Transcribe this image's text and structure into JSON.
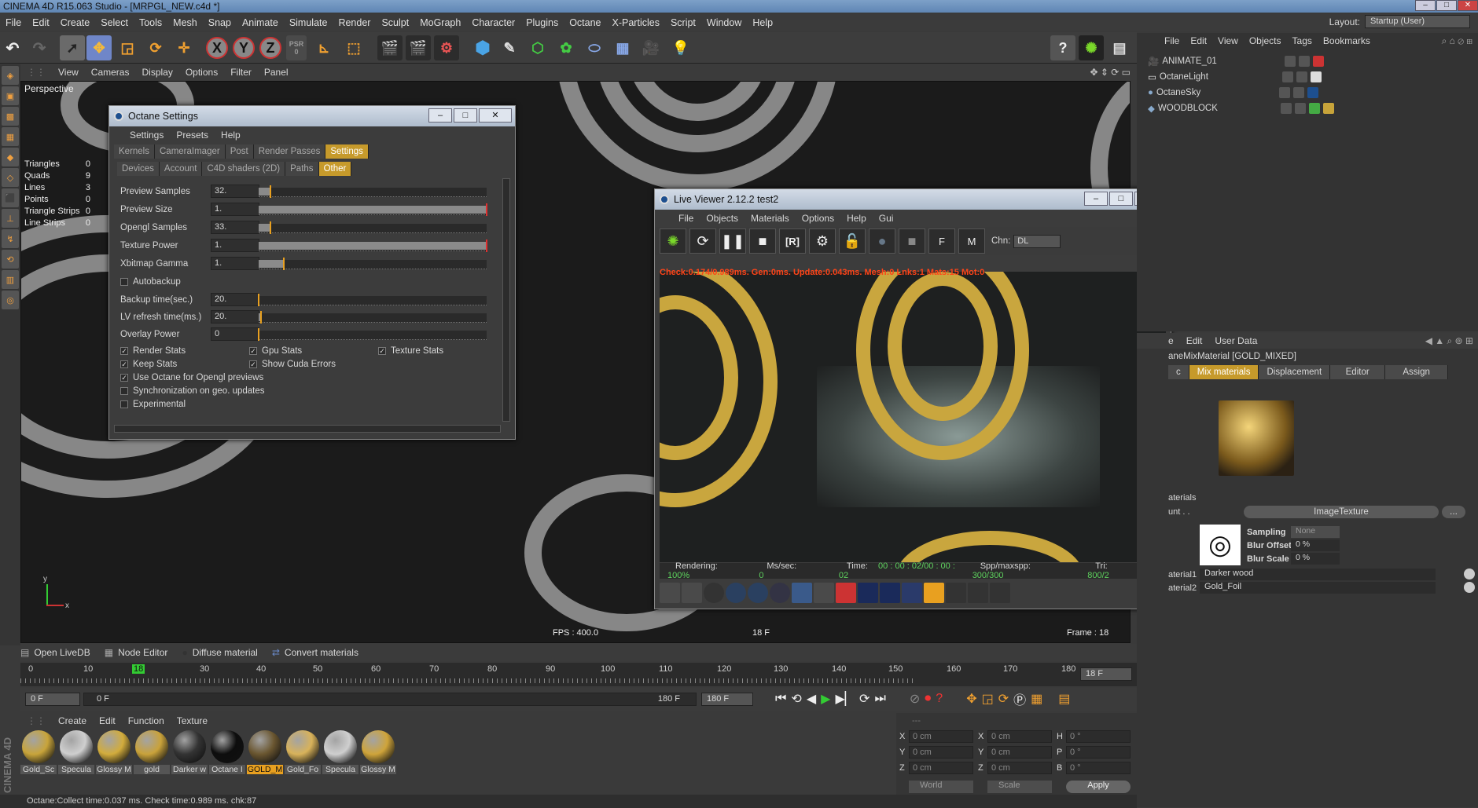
{
  "window": {
    "title": "CINEMA 4D R15.063 Studio - [MRPGL_NEW.c4d *]"
  },
  "menu": [
    "File",
    "Edit",
    "Create",
    "Select",
    "Tools",
    "Mesh",
    "Snap",
    "Animate",
    "Simulate",
    "Render",
    "Sculpt",
    "MoGraph",
    "Character",
    "Plugins",
    "Octane",
    "X-Particles",
    "Script",
    "Window",
    "Help"
  ],
  "layout": {
    "label": "Layout:",
    "value": "Startup (User)"
  },
  "toolbar": {
    "x": "X",
    "y": "Y",
    "z": "Z",
    "psr": "PSR",
    "psr_num": "0",
    "help": "?"
  },
  "viewport": {
    "menu": [
      "View",
      "Cameras",
      "Display",
      "Options",
      "Filter",
      "Panel"
    ],
    "label": "Perspective",
    "stats": [
      {
        "k": "Triangles",
        "v": "0"
      },
      {
        "k": "Quads",
        "v": "9"
      },
      {
        "k": "Lines",
        "v": "3"
      },
      {
        "k": "Points",
        "v": "0"
      },
      {
        "k": "Triangle Strips",
        "v": "0"
      },
      {
        "k": "Line Strips",
        "v": "0"
      }
    ],
    "fps": "FPS : 400.0",
    "frame_mid": "18 F",
    "frame": "Frame : 18",
    "axis_y": "y",
    "axis_x": "x"
  },
  "octane_settings": {
    "title": "Octane Settings",
    "menu": [
      "Settings",
      "Presets",
      "Help"
    ],
    "tabs1": [
      "Kernels",
      "CameraImager",
      "Post",
      "Render Passes",
      "Settings"
    ],
    "tabs2": [
      "Devices",
      "Account",
      "C4D shaders (2D)",
      "Paths",
      "Other"
    ],
    "sliders": [
      {
        "label": "Preview Samples",
        "value": "32.",
        "level": 0.05
      },
      {
        "label": "Preview Size",
        "value": "1.",
        "level": 1.0
      },
      {
        "label": "Opengl Samples",
        "value": "33.",
        "level": 0.05
      },
      {
        "label": "Texture Power",
        "value": "1.",
        "level": 1.0
      },
      {
        "label": "Xbitmap Gamma",
        "value": "1.",
        "level": 0.11
      }
    ],
    "autobackup": "Autobackup",
    "sliders2": [
      {
        "label": "Backup time(sec.)",
        "value": "20.",
        "level": 0.0
      },
      {
        "label": "LV refresh time(ms.)",
        "value": "20.",
        "level": 0.01
      },
      {
        "label": "Overlay Power",
        "value": "0",
        "level": 0.0
      }
    ],
    "checks": {
      "render_stats": "Render Stats",
      "gpu_stats": "Gpu Stats",
      "texture_stats": "Texture Stats",
      "keep_stats": "Keep Stats",
      "cuda_errors": "Show Cuda Errors",
      "opengl_prev": "Use Octane for Opengl previews",
      "sync": "Synchronization on geo. updates",
      "experimental": "Experimental"
    }
  },
  "live_viewer": {
    "title": "Live Viewer 2.12.2 test2",
    "menu": [
      "File",
      "Objects",
      "Materials",
      "Options",
      "Help",
      "Gui"
    ],
    "chn_label": "Chn:",
    "chn_value": "DL",
    "status": "Check:0.174/0.989ms. Gen:0ms. Update:0.043ms. Mesh:0 Lnks:1 Mats:15 Mot:0",
    "stats": {
      "rendering_k": "Rendering:",
      "rendering_v": "100%",
      "ms_k": "Ms/sec:",
      "ms_v": "0",
      "time_k": "Time:",
      "time_v": "00 : 00 : 02/00 : 00 : 02",
      "spp_k": "Spp/maxspp:",
      "spp_v": "300/300",
      "tri_k": "Tri:",
      "tri_v": "800/2",
      "extra": "M"
    }
  },
  "object_manager": {
    "menu": [
      "File",
      "Edit",
      "View",
      "Objects",
      "Tags",
      "Bookmarks"
    ],
    "items": [
      "ANIMATE_01",
      "OctaneLight",
      "OctaneSky",
      "WOODBLOCK"
    ]
  },
  "attribute_manager": {
    "menu": [
      "e",
      "Edit",
      "User Data"
    ],
    "title": "aneMixMaterial [GOLD_MIXED]",
    "tabs": [
      "c",
      "Mix materials",
      "Displacement",
      "Editor",
      "Assign"
    ],
    "section": "aterials",
    "shader_label": "unt . .",
    "shader_name": "ImageTexture",
    "more": "...",
    "sampling_k": "Sampling",
    "sampling_v": "None",
    "blur_offset_k": "Blur Offset",
    "blur_offset_v": "0 %",
    "blur_scale_k": "Blur Scale",
    "blur_scale_v": "0 %",
    "mat1_k": "aterial1",
    "mat1_v": "Darker wood",
    "mat2_k": "aterial2",
    "mat2_v": "Gold_Foil"
  },
  "timeline": {
    "bar": [
      "Open LiveDB",
      "Node Editor",
      "Diffuse material",
      "Convert materials"
    ],
    "ticks": [
      "0",
      "10",
      "18",
      "30",
      "40",
      "50",
      "60",
      "70",
      "80",
      "90",
      "100",
      "110",
      "120",
      "130",
      "140",
      "150",
      "160",
      "170",
      "180"
    ],
    "current": "18 F",
    "start": "0 F",
    "range_start": "0 F",
    "range_end": "180 F",
    "end": "180 F"
  },
  "material_manager": {
    "menu": [
      "Create",
      "Edit",
      "Function",
      "Texture"
    ],
    "items": [
      {
        "label": "Gold_Sc",
        "color": "#c8a43a"
      },
      {
        "label": "Specula",
        "color": "#cfcfcf"
      },
      {
        "label": "Glossy M",
        "color": "#d2ac3c"
      },
      {
        "label": "gold",
        "color": "#c9a23a"
      },
      {
        "label": "Darker w",
        "color": "#333333"
      },
      {
        "label": "Octane I",
        "color": "#0d0d0d"
      },
      {
        "label": "GOLD_M",
        "color": "#6a5630"
      },
      {
        "label": "Gold_Fo",
        "color": "#d8b25a"
      },
      {
        "label": "Specula",
        "color": "#cfcfcf"
      },
      {
        "label": "Glossy M",
        "color": "#cfa43a"
      }
    ]
  },
  "coords": {
    "header": "---",
    "x": "0 cm",
    "y": "0 cm",
    "z": "0 cm",
    "sx": "0 cm",
    "sy": "0 cm",
    "sz": "0 cm",
    "h": "0 °",
    "p": "0 °",
    "b": "0 °",
    "world": "World",
    "scale": "Scale",
    "apply": "Apply"
  },
  "statusbar": "Octane:Collect time:0.037 ms.  Check time:0.989 ms.  chk:87",
  "app_logo": "CINEMA 4D"
}
